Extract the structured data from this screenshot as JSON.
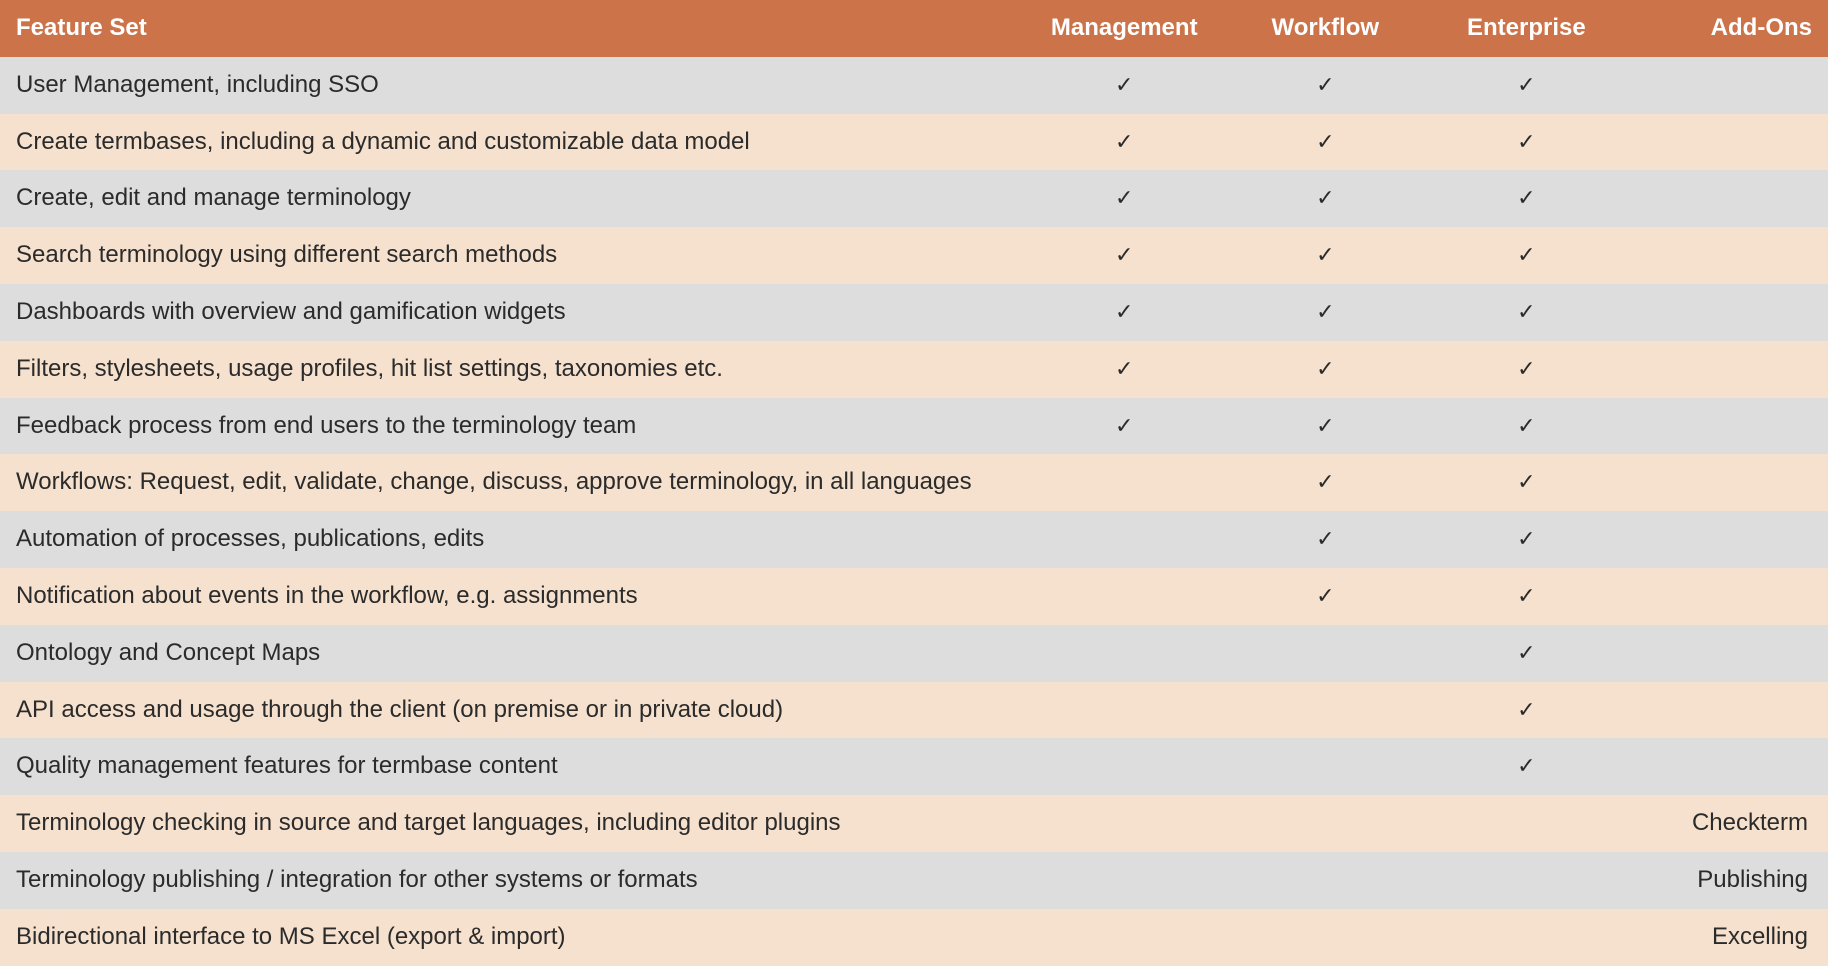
{
  "check_glyph": "✓",
  "columns": {
    "feature": "Feature Set",
    "management": "Management",
    "workflow": "Workflow",
    "enterprise": "Enterprise",
    "addons": "Add-Ons"
  },
  "rows": [
    {
      "feature": "User Management, including SSO",
      "management": true,
      "workflow": true,
      "enterprise": true,
      "addons": ""
    },
    {
      "feature": "Create termbases, including a dynamic and customizable data model",
      "management": true,
      "workflow": true,
      "enterprise": true,
      "addons": ""
    },
    {
      "feature": "Create, edit and manage terminology",
      "management": true,
      "workflow": true,
      "enterprise": true,
      "addons": ""
    },
    {
      "feature": "Search terminology using different search methods",
      "management": true,
      "workflow": true,
      "enterprise": true,
      "addons": ""
    },
    {
      "feature": "Dashboards with overview and gamification widgets",
      "management": true,
      "workflow": true,
      "enterprise": true,
      "addons": ""
    },
    {
      "feature": "Filters, stylesheets, usage profiles, hit list settings, taxonomies etc.",
      "management": true,
      "workflow": true,
      "enterprise": true,
      "addons": ""
    },
    {
      "feature": "Feedback process from end users to the terminology team",
      "management": true,
      "workflow": true,
      "enterprise": true,
      "addons": ""
    },
    {
      "feature": "Workflows: Request, edit, validate, change, discuss, approve terminology, in all languages",
      "management": false,
      "workflow": true,
      "enterprise": true,
      "addons": ""
    },
    {
      "feature": "Automation of processes, publications, edits",
      "management": false,
      "workflow": true,
      "enterprise": true,
      "addons": ""
    },
    {
      "feature": "Notification about events in the workflow, e.g. assignments",
      "management": false,
      "workflow": true,
      "enterprise": true,
      "addons": ""
    },
    {
      "feature": "Ontology and Concept Maps",
      "management": false,
      "workflow": false,
      "enterprise": true,
      "addons": ""
    },
    {
      "feature": "API access and usage through the client (on premise or in private cloud)",
      "management": false,
      "workflow": false,
      "enterprise": true,
      "addons": ""
    },
    {
      "feature": "Quality management features for termbase content",
      "management": false,
      "workflow": false,
      "enterprise": true,
      "addons": ""
    },
    {
      "feature": "Terminology checking in source and target languages, including editor plugins",
      "management": false,
      "workflow": false,
      "enterprise": false,
      "addons": "Checkterm"
    },
    {
      "feature": "Terminology publishing / integration for other systems or formats",
      "management": false,
      "workflow": false,
      "enterprise": false,
      "addons": "Publishing"
    },
    {
      "feature": "Bidirectional interface to MS Excel (export & import)",
      "management": false,
      "workflow": false,
      "enterprise": false,
      "addons": "Excelling"
    }
  ]
}
